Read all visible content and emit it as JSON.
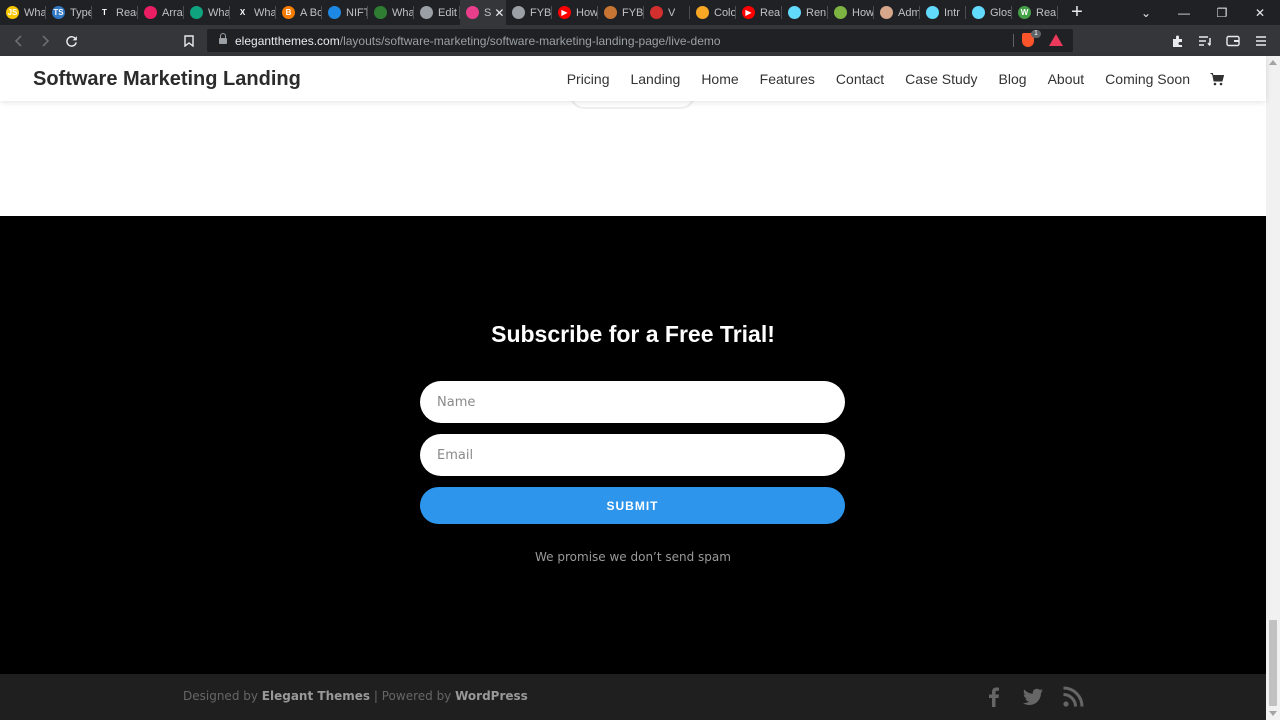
{
  "browser": {
    "tabs": [
      {
        "title": "Wha",
        "fav_color": "#f7c600",
        "fav_text": "JS"
      },
      {
        "title": "Type",
        "fav_color": "#3178c6",
        "fav_text": "TS"
      },
      {
        "title": "Reac",
        "fav_color": "#202124",
        "fav_text": "T"
      },
      {
        "title": "Arra",
        "fav_color": "#e91e63",
        "fav_text": ""
      },
      {
        "title": "Wha",
        "fav_color": "#10a37f",
        "fav_text": ""
      },
      {
        "title": "Wha",
        "fav_color": "#202124",
        "fav_text": "X"
      },
      {
        "title": "A Bo",
        "fav_color": "#f57c00",
        "fav_text": "B"
      },
      {
        "title": "NIFT",
        "fav_color": "#1e88e5",
        "fav_text": ""
      },
      {
        "title": "Wha",
        "fav_color": "#2e7d32",
        "fav_text": ""
      },
      {
        "title": "Edit",
        "fav_color": "#9aa0a6",
        "fav_text": ""
      },
      {
        "title": "S",
        "fav_color": "#e83e8c",
        "fav_text": "",
        "active": true
      },
      {
        "title": "FYBI",
        "fav_color": "#9aa0a6",
        "fav_text": ""
      },
      {
        "title": "How",
        "fav_color": "#ff0000",
        "fav_text": "▶"
      },
      {
        "title": "FYBI",
        "fav_color": "#c87533",
        "fav_text": ""
      },
      {
        "title": "V",
        "fav_color": "#d32f2f",
        "fav_text": ""
      },
      {
        "title": "Colo",
        "fav_color": "#f9a825",
        "fav_text": ""
      },
      {
        "title": "Rea",
        "fav_color": "#ff0000",
        "fav_text": "▶"
      },
      {
        "title": "Ren",
        "fav_color": "#61dafb",
        "fav_text": ""
      },
      {
        "title": "How",
        "fav_color": "#7cb342",
        "fav_text": ""
      },
      {
        "title": "Adm",
        "fav_color": "#d7a78b",
        "fav_text": ""
      },
      {
        "title": "Intr",
        "fav_color": "#61dafb",
        "fav_text": ""
      },
      {
        "title": "Glos",
        "fav_color": "#61dafb",
        "fav_text": ""
      },
      {
        "title": "Rea",
        "fav_color": "#43a047",
        "fav_text": "W"
      }
    ],
    "url_host": "elegantthemes.com",
    "url_path": "/layouts/software-marketing/software-marketing-landing-page/live-demo",
    "shield_count": "1"
  },
  "site": {
    "logo": "Software Marketing Landing",
    "nav": [
      "Pricing",
      "Landing",
      "Home",
      "Features",
      "Contact",
      "Case Study",
      "Blog",
      "About",
      "Coming Soon"
    ]
  },
  "signup": {
    "title": "Subscribe for a Free Trial!",
    "name_placeholder": "Name",
    "email_placeholder": "Email",
    "submit_label": "SUBMIT",
    "note": "We promise we don’t send spam"
  },
  "footer": {
    "designed_by": "Designed by",
    "elegant": "Elegant Themes",
    "powered_sep": "| Powered by",
    "wordpress": "WordPress"
  },
  "colors": {
    "accent": "#2d95ec",
    "signup_bg": "#000000",
    "footer_bg": "#1f1f1f"
  }
}
